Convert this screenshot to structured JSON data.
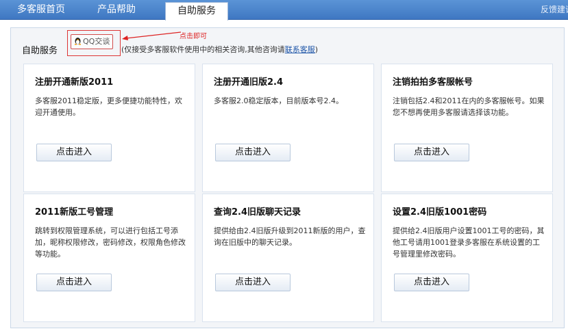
{
  "nav": {
    "tabs": [
      {
        "label": "多客服首页"
      },
      {
        "label": "产品帮助"
      },
      {
        "label": "自助服务"
      }
    ],
    "right_text": "反馈建议"
  },
  "section": {
    "title": "自助服务",
    "qq_button": "QQ交谈",
    "note_prefix": "(仅接受多客服软件使用中的相关咨询,其他咨询请",
    "note_link": "联系客服",
    "note_suffix": ")",
    "hint": "点击即可"
  },
  "cards": [
    {
      "title": "注册开通新版2011",
      "desc": "多客服2011稳定版，更多便捷功能特性，欢迎开通使用。",
      "button": "点击进入"
    },
    {
      "title": "注册开通旧版2.4",
      "desc": "多客服2.0稳定版本，目前版本号2.4。",
      "button": "点击进入"
    },
    {
      "title": "注销拍拍多客服帐号",
      "desc": "注销包括2.4和2011在内的多客服帐号。如果您不想再使用多客服请选择该功能。",
      "button": "点击进入"
    },
    {
      "title": "2011新版工号管理",
      "desc": "跳转到权限管理系统，可以进行包括工号添加，昵称权限修改，密码修改，权限角色修改等功能。",
      "button": "点击进入"
    },
    {
      "title": "查询2.4旧版聊天记录",
      "desc": "提供给由2.4旧版升级到2011新版的用户，查询在旧版中的聊天记录。",
      "button": "点击进入"
    },
    {
      "title": "设置2.4旧版1001密码",
      "desc": "提供给2.4旧版用户设置1001工号的密码，其他工号请用1001登录多客服在系统设置的工号管理里修改密码。",
      "button": "点击进入"
    }
  ],
  "colors": {
    "nav_bg": "#4a83cc",
    "hint_red": "#dd2222",
    "link_blue": "#1f56a8"
  },
  "icons": {
    "qq": "qq-penguin-icon",
    "arrow": "pointer-arrow-icon"
  }
}
